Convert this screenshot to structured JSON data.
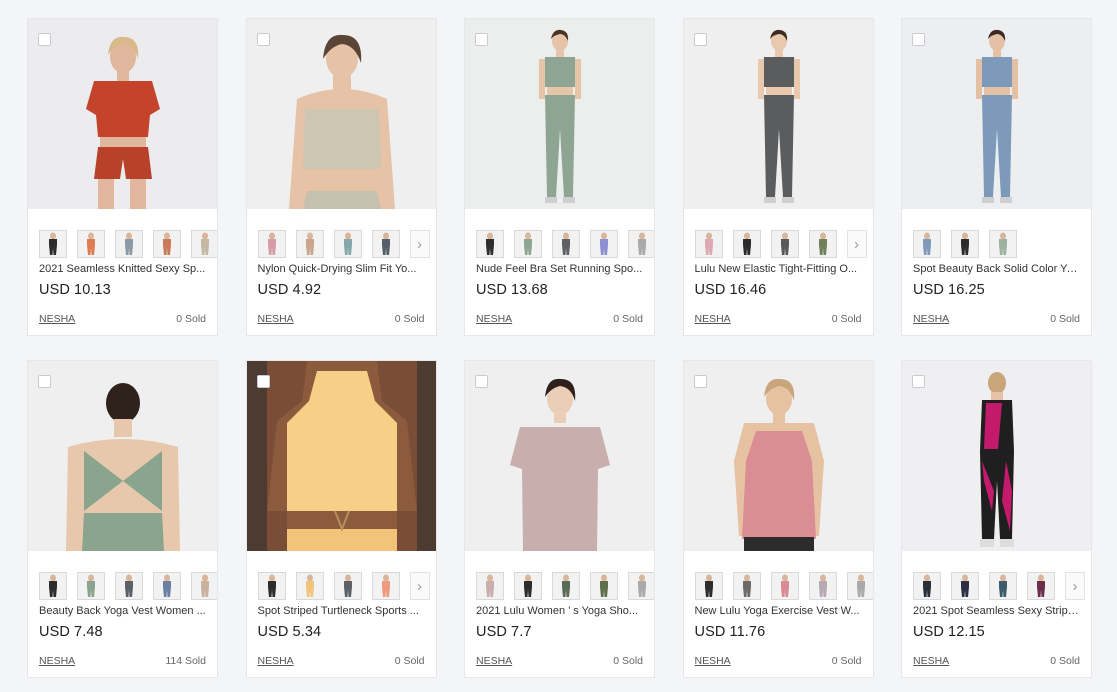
{
  "products": [
    {
      "title": "2021 Seamless Knitted Sexy Sp...",
      "price": "USD 10.13",
      "store": "NESHA",
      "sold": "0 Sold",
      "image": {
        "bg": "#ececee",
        "top": "#c4432b",
        "bottom": "#b8412a",
        "skin": "#e0b79c",
        "hair": "#d9b98a",
        "style": "shorts"
      },
      "swatches": [
        "#2b2b2b",
        "#e07a52",
        "#8d9aa6",
        "#c87a5a",
        "#c5b8a3"
      ],
      "has_more": true
    },
    {
      "title": "Nylon Quick-Drying Slim Fit Yo...",
      "price": "USD 4.92",
      "store": "NESHA",
      "sold": "0 Sold",
      "image": {
        "bg": "#efefef",
        "top": "#ccc6b3",
        "bottom": "#c6c0ae",
        "skin": "#e6c3a6",
        "hair": "#5a4435",
        "style": "bra"
      },
      "swatches": [
        "#d79aa9",
        "#c9a58f",
        "#84a8a8",
        "#555d66"
      ],
      "has_more": true
    },
    {
      "title": "Nude Feel Bra Set Running Spo...",
      "price": "USD 13.68",
      "store": "NESHA",
      "sold": "0 Sold",
      "image": {
        "bg": "#eceded",
        "top": "#8ea593",
        "bottom": "#8ea593",
        "skin": "#e6c4a8",
        "hair": "#4a3326",
        "style": "full"
      },
      "swatches": [
        "#2f2f2f",
        "#8ea593",
        "#5d6065",
        "#8d8fd3",
        "#aaaaaa"
      ],
      "has_more": true
    },
    {
      "title": "Lulu New Elastic Tight-Fitting O...",
      "price": "USD 16.46",
      "store": "NESHA",
      "sold": "0 Sold",
      "image": {
        "bg": "#efefef",
        "top": "#5a5c5e",
        "bottom": "#5a5c5e",
        "skin": "#e8c9ad",
        "hair": "#3d2c22",
        "style": "full"
      },
      "swatches": [
        "#dca9b3",
        "#2c2c2c",
        "#58595b",
        "#708059"
      ],
      "has_more": true
    },
    {
      "title": "Spot Beauty Back Solid Color Yo...",
      "price": "USD 16.25",
      "store": "NESHA",
      "sold": "0 Sold",
      "image": {
        "bg": "#eceef0",
        "top": "#7d9abb",
        "bottom": "#7d9abb",
        "skin": "#e4c1a5",
        "hair": "#3a2a22",
        "style": "full"
      },
      "swatches": [
        "#7d9abb",
        "#2c2c2c",
        "#9cb3a2"
      ],
      "has_more": false
    },
    {
      "title": "Beauty Back Yoga Vest Women ...",
      "price": "USD 7.48",
      "store": "NESHA",
      "sold": "114 Sold",
      "image": {
        "bg": "#efefef",
        "top": "#8aa58e",
        "bottom": "#8aa58e",
        "skin": "#e8c8ad",
        "hair": "#2f211b",
        "style": "back"
      },
      "swatches": [
        "#2c2c2c",
        "#8aa58e",
        "#5c6066",
        "#6b7fa2",
        "#c9b1a0"
      ],
      "has_more": true
    },
    {
      "title": "Spot Striped Turtleneck Sports ...",
      "price": "USD 5.34",
      "store": "NESHA",
      "sold": "0 Sold",
      "image": {
        "bg": "#4d3a30",
        "top": "#f7cf86",
        "bottom": "#f2c47a",
        "skin": "#8c5a3c",
        "hair": "#2c1c16",
        "style": "crop"
      },
      "swatches": [
        "#2c2c2c",
        "#f2c47a",
        "#5d6065",
        "#ee9a7c"
      ],
      "has_more": true
    },
    {
      "title": "2021 Lulu Women ’ s Yoga Sho...",
      "price": "USD 7.7",
      "store": "NESHA",
      "sold": "0 Sold",
      "image": {
        "bg": "#efefef",
        "top": "#c9aeae",
        "bottom": "#c9aeae",
        "skin": "#ecceb6",
        "hair": "#2e211b",
        "style": "tee"
      },
      "swatches": [
        "#c9aeae",
        "#2c2c2c",
        "#5b6a57",
        "#5f6f4c",
        "#aaaaaa"
      ],
      "has_more": true
    },
    {
      "title": "New Lulu Yoga Exercise Vest W...",
      "price": "USD 11.76",
      "store": "NESHA",
      "sold": "0 Sold",
      "image": {
        "bg": "#efefef",
        "top": "#db8d95",
        "bottom": "#2c2c2c",
        "skin": "#e6c2a3",
        "hair": "#caa57c",
        "style": "vest"
      },
      "swatches": [
        "#2c2c2c",
        "#6d6a68",
        "#d98a92",
        "#b6a9b2",
        "#aaaaaa"
      ],
      "has_more": true
    },
    {
      "title": "2021 Spot Seamless Sexy Stripe...",
      "price": "USD 12.15",
      "store": "NESHA",
      "sold": "0 Sold",
      "image": {
        "bg": "#efeff1",
        "top": "#c41a6b",
        "bottom": "#1f1f1f",
        "skin": "#e6c1a6",
        "hair": "#c8a679",
        "style": "stripe"
      },
      "swatches": [
        "#2b2f3a",
        "#2c2f44",
        "#3c5b6c",
        "#6b2f4d"
      ],
      "has_more": true
    }
  ],
  "icons": {
    "next": "chevron-right-icon",
    "select": "checkbox-icon"
  }
}
